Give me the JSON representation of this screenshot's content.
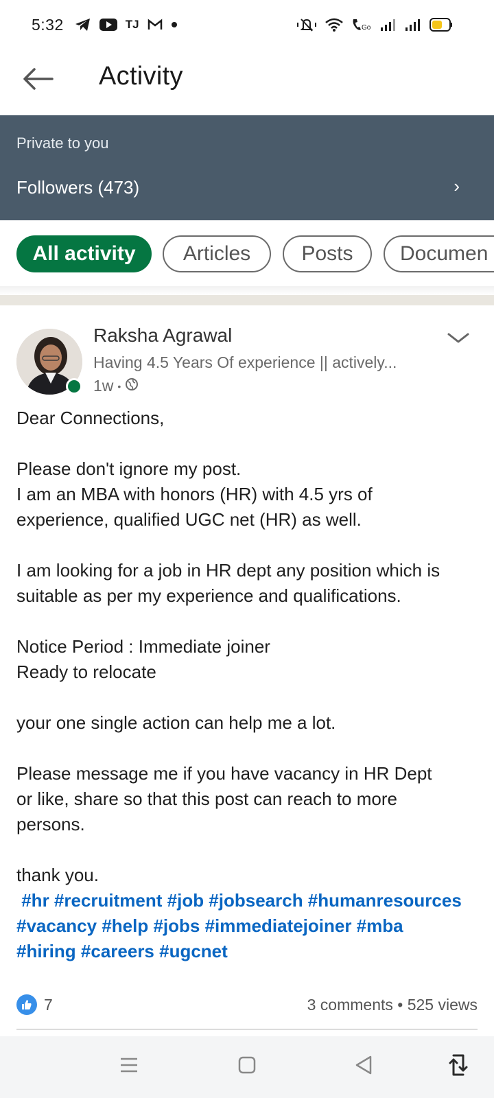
{
  "status_bar": {
    "time": "5:32",
    "left_icons": [
      "telegram-icon",
      "youtube-icon",
      "tj-icon",
      "gmail-icon",
      "dot-icon"
    ],
    "left_text_icon": "TJ",
    "right_icons": [
      "mute-icon",
      "wifi-icon",
      "volte-icon",
      "signal-icon",
      "signal-icon",
      "battery-icon"
    ],
    "battery_color": "#f5c518"
  },
  "header": {
    "title": "Activity",
    "back_icon": "arrow-left-icon"
  },
  "private_banner": {
    "label": "Private to you",
    "followers": "Followers (473)",
    "chevron": "›",
    "background": "#4a5b6a"
  },
  "filters": {
    "chips": [
      {
        "label": "All activity",
        "active": true
      },
      {
        "label": "Articles",
        "active": false
      },
      {
        "label": "Posts",
        "active": false
      },
      {
        "label": "Documen",
        "active": false
      }
    ],
    "active_color": "#057642"
  },
  "post": {
    "author": {
      "name": "Raksha Agrawal",
      "headline": "Having 4.5 Years Of experience || actively...",
      "time": "1w",
      "separator": "•",
      "visibility_icon": "globe-icon",
      "online": true
    },
    "menu_icon": "chevron-down-icon",
    "body": {
      "greeting": "Dear Connections,",
      "p1_l1": "Please don't ignore my post.",
      "p1_l2": "I am an MBA with honors (HR) with 4.5 yrs of",
      "p1_l3": "experience, qualified UGC net (HR) as well.",
      "p2_l1": "I am looking for a job in HR dept any position which is",
      "p2_l2": "suitable as per my experience and qualifications.",
      "p3_l1": "Notice Period : Immediate joiner",
      "p3_l2": "Ready to relocate",
      "p4_l1": "your one single action can help me a lot.",
      "p5_l1": "Please message me if you have vacancy in HR Dept",
      "p5_l2": "or like, share so that this post can reach to more",
      "p5_l3": "persons.",
      "closing": "thank you.",
      "hashtags_l1": " #hr #recruitment #job #jobsearch #humanresources",
      "hashtags_l2": "#vacancy #help #jobs #immediatejoiner #mba",
      "hashtags_l3": "#hiring #careers #ugcnet"
    },
    "social": {
      "like_icon": "like-icon",
      "like_count": "7",
      "engagement": "3 comments • 525 views"
    }
  },
  "nav_bar": {
    "buttons": [
      "menu-icon",
      "home-square-icon",
      "back-triangle-icon",
      "rotate-icon"
    ]
  }
}
